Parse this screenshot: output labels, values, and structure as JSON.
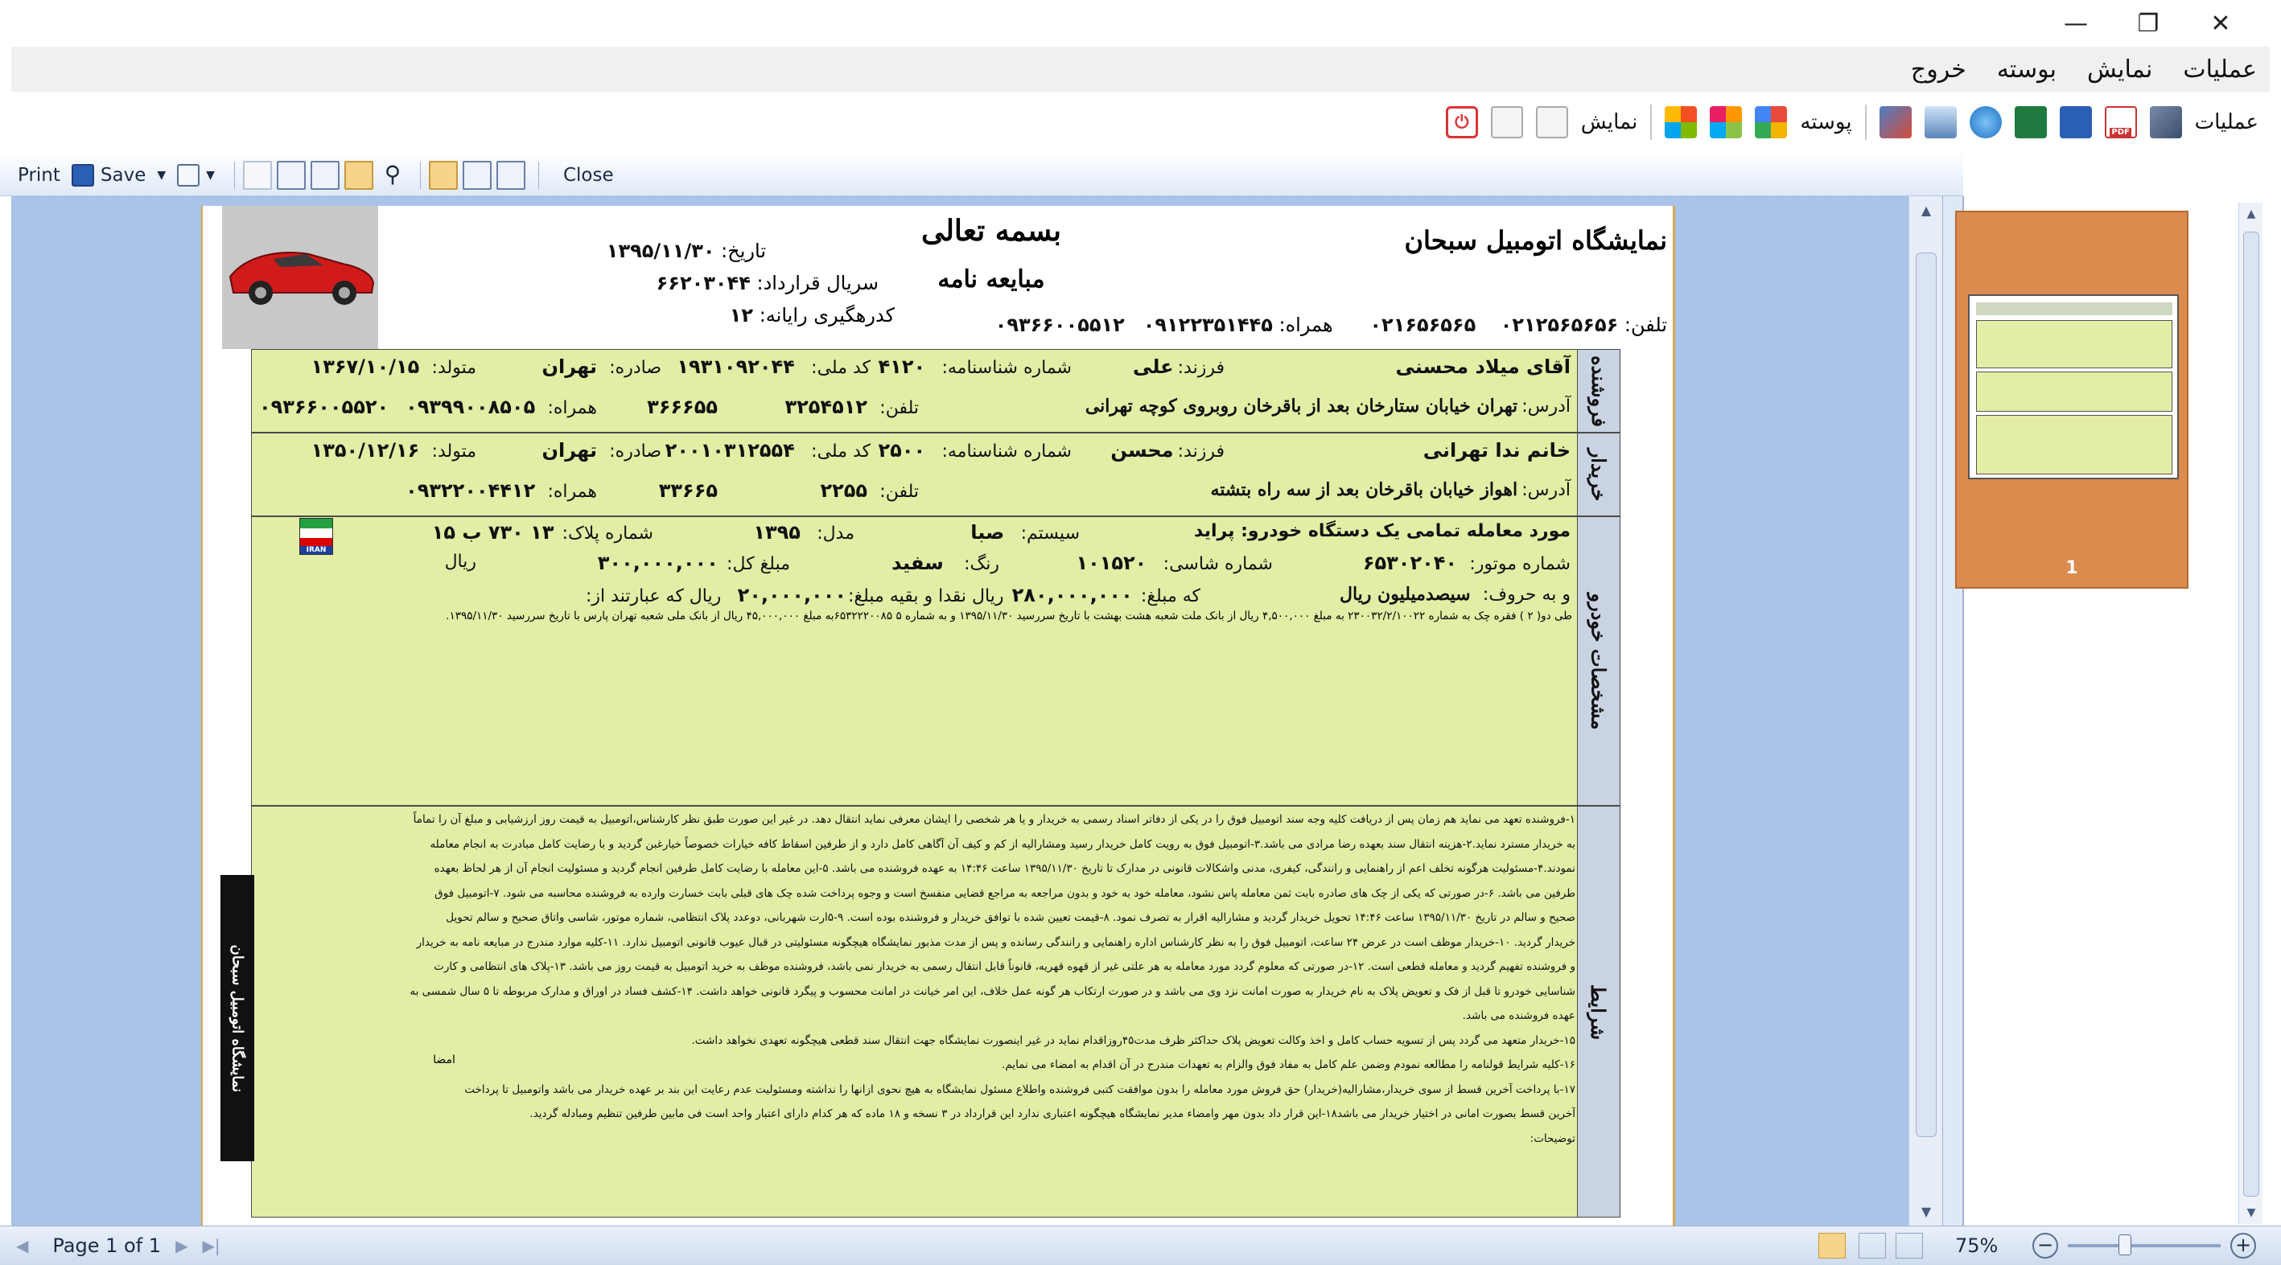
{
  "window": {
    "minimize_glyph": "—",
    "restore_glyph": "❐",
    "close_glyph": "✕"
  },
  "menu": {
    "items": [
      "عملیات",
      "نمایش",
      "بوسته",
      "خروج"
    ]
  },
  "icon_toolbar": {
    "operations_label": "عملیات",
    "skin_label": "پوسته",
    "view_label": "نمایش"
  },
  "viewer_toolbar": {
    "print_label": "Print",
    "save_label": "Save",
    "close_label": "Close"
  },
  "report": {
    "company_name": "نمایشگاه اتومبیل سبحان",
    "heading": "بسمه تعالی",
    "doc_title": "مبایعه نامه",
    "date_label": "تاریخ:",
    "date_value": "۱۳۹۵/۱۱/۳۰",
    "contract_serial_label": "سریال قرارداد:",
    "contract_serial_value": "۶۶۲۰۳۰۴۴",
    "tracking_label": "کدرهگیری رایانه:",
    "tracking_value": "۱۲",
    "phone_label": "تلفن:",
    "phone_1": "۰۲۱۲۵۶۵۶۵۶",
    "phone_2": "۰۲۱۶۵۶۵۶۵",
    "mobile_label": "همراه:",
    "mobile_1": "۰۹۱۲۲۳۵۱۴۴۵",
    "mobile_2": "۰۹۳۶۶۰۰۵۵۱۲",
    "seller": {
      "section_label": "فروشنده",
      "name": "آقای میلاد محسنی",
      "father_label": "فرزند:",
      "father": "علی",
      "id_no_label": "شماره شناسنامه:",
      "id_no": "۴۱۲۰",
      "national_code_label": "کد ملی:",
      "national_code": "۱۹۳۱۰۹۲۰۴۴",
      "issued_label": "صادره:",
      "issued": "تهران",
      "born_label": "متولد:",
      "born": "۱۳۶۷/۱۰/۱۵",
      "address_label": "آدرس:",
      "address": "تهران خیابان ستارخان بعد از باقرخان روبروی کوچه تهرانی",
      "phone_label": "تلفن:",
      "phone": "۳۲۵۴۵۱۲",
      "phone2": "۳۶۶۶۵۵",
      "mobile_label": "همراه:",
      "mobile": "۰۹۳۹۹۰۰۸۵۰۵",
      "mobile2": "۰۹۳۶۶۰۰۵۵۲۰"
    },
    "buyer": {
      "section_label": "خریدار",
      "name": "خانم ندا تهرانی",
      "father_label": "فرزند:",
      "father": "محسن",
      "id_no_label": "شماره شناسنامه:",
      "id_no": "۲۵۰۰",
      "national_code_label": "کد ملی:",
      "national_code": "۲۰۰۱۰۳۱۲۵۵۴",
      "issued_label": "صادره:",
      "issued": "تهران",
      "born_label": "متولد:",
      "born": "۱۳۵۰/۱۲/۱۶",
      "address_label": "آدرس:",
      "address": "اهواز خیابان باقرخان بعد از سه راه بتشته",
      "phone_label": "تلفن:",
      "phone": "۲۲۵۵",
      "phone2": "۳۳۶۶۵",
      "mobile_label": "همراه:",
      "mobile": "۰۹۳۲۲۰۰۴۴۱۲"
    },
    "vehicle": {
      "section_label": "مشخصات خودرو",
      "subject": "مورد معامله تمامی یک دستگاه خودرو: پراید",
      "system_label": "سیستم:",
      "system": "صبا",
      "model_label": "مدل:",
      "model": "۱۳۹۵",
      "plate_label": "شماره پلاک:",
      "plate": "۱۳ ۷۳۰ ب ۱۵",
      "plate_country": "IRAN",
      "engine_label": "شماره موتور:",
      "engine": "۶۵۳۰۲۰۴۰",
      "chassis_label": "شماره شاسی:",
      "chassis": "۱۰۱۵۲۰",
      "color_label": "رنگ:",
      "color": "سفید",
      "total_label": "مبلغ کل:",
      "total": "۳۰۰,۰۰۰,۰۰۰",
      "rial": "ریال",
      "words_label": "و به حروف:",
      "words": "سیصدمیلیون ریال",
      "paid_label": "که مبلغ:",
      "paid": "۲۸۰,۰۰۰,۰۰۰",
      "paid_suffix": "ریال نقدا و بقیه مبلغ:",
      "rest": "۲۰,۰۰۰,۰۰۰",
      "rest_suffix": "ریال که عبارتند از:",
      "cheques": "طی دو( ۲ ) فقره چک به شماره ۲۳۰۰۳۲/۲/۱۰۰۲۲ به مبلغ ۴,۵۰۰,۰۰۰ ریال  از بانک ملت شعبه هشت بهشت با تاریخ سررسید ۱۳۹۵/۱۱/۳۰ و به شماره ۵ ۶۵۳۲۲۲۰۰۸۵به مبلغ ۴۵,۰۰۰,۰۰۰ ریال  از بانک ملی شعبه تهران پارس با تاریخ سررسید ۱۳۹۵/۱۱/۳۰."
    },
    "terms": {
      "section_label": "شرایط",
      "side_stamp": "نمایشگاه اتومبیل سبحان",
      "lines": [
        "۱-فروشنده تعهد می نماید هم زمان پس از دریافت کلیه وجه سند اتومبیل فوق را در یکی از دفاتر اسناد رسمی به خریدار و یا هر شخصی را ایشان معرفی نماید انتقال دهد. در غیر این صورت طبق نظر کارشناس،اتومبیل به قیمت روز ارزشیابی و مبلغ آن را تماماً",
        "به خریدار مسترد نماید.۲-هزینه انتقال سند بعهده رضا مرادی می باشد.۳-اتومبیل فوق به رویت کامل خریدار رسید ومشارالیه از کم و کیف آن آگاهی کامل دارد و از طرفین اسقاط کافه خیارات خصوصاً خیارغبن گردید و با رضایت کامل مبادرت به انجام معامله",
        "نمودند.۴-مسئولیت هرگونه تخلف اعم از راهنمایی و رانندگی، کیفری، مدنی واشکالات قانونی در مدارک تا تاریخ ۱۳۹۵/۱۱/۳۰ ساعت ۱۴:۴۶ به عهده فروشنده می باشد. ۵-این معامله با رضایت کامل طرفین انجام گردید و مسئولیت انجام آن از هر لحاظ بعهده",
        "طرفین می باشد. ۶-در صورتی که یکی از چک های صادره بابت ثمن معامله پاس نشود، معامله خود به خود و بدون مراجعه به مراجع قضایی منفسخ است و وجوه پرداخت شده چک های قبلی بابت خسارت وارده به فروشنده محاسبه می شود. ۷-اتومبیل فوق",
        "صحیح و سالم در تاریخ ۱۳۹۵/۱۱/۳۰ ساعت ۱۴:۴۶ تحویل خریدار گردید و مشارالیه اقرار به تصرف نمود. ۸-قیمت تعیین شده با توافق خریدار و فروشنده بوده است. ۹-۵ارت شهربانی، دوعدد پلاک انتظامی، شماره موتور، شاسی واتاق صحیح و سالم تحویل",
        "خریدار گردید. ۱۰-خریدار موظف است در عرض ۲۴ ساعت، اتومبیل فوق را به نظر کارشناس اداره راهنمایی و رانندگی رسانده و پس از مدت مذبور نمایشگاه هیچگونه مسئولیتی در قبال عیوب قانونی اتومبیل ندارد. ۱۱-کلیه موارد مندرج در مبایعه نامه به خریدار",
        "و فروشنده تفهیم گردید و معامله قطعی است. ۱۲-در صورتی که معلوم گردد مورد معامله به هر علتی غیر از قهوه قهریه، قانوناً قابل انتقال رسمی به خریدار نمی باشد، فروشنده موظف به خرید اتومبیل به قیمت روز می باشد. ۱۳-پلاک های انتظامی و کارت",
        "شناسایی خودرو تا قبل از فک و تعویض پلاک به نام خریدار به صورت امانت نزد وی می باشد و در صورت ارتکاب هر گونه عمل خلاف، این امر خیانت در امانت محسوب و پیگرد قانونی خواهد داشت. ۱۴-کشف فساد در اوراق و مدارک مربوطه تا ۵ سال شمسی به",
        "عهده فروشنده می باشد.",
        "۱۵-خریدار متعهد می گردد پس از تسویه حساب کامل و اخذ وکالت تعویض پلاک حداکثر ظرف مدت۴۵روزاقدام نماید در غیر اینصورت نمایشگاه جهت انتقال سند قطعی هیچگونه تعهدی نخواهد داشت.",
        "۱۶-کلیه شرایط قولنامه را مطالعه نمودم وضمن علم کامل به مفاد فوق والزام به تعهدات مندرج در آن اقدام به امضاء می نمایم.",
        "۱۷-با پرداخت آخرین قسط از سوی خریدار،مشارالیه(خریدار) حق فروش مورد معامله را بدون موافقت کتبی فروشنده واطلاع مسئول نمایشگاه به هیچ نحوی ازانها را نداشته ومسئولیت عدم رعایت این بند بر عهده خریدار می باشد واتومبیل تا پرداخت",
        "آخرین قسط بصورت امانی در اختیار خریدار می باشد۱۸-این قرار داد بدون مهر وامضاء مدیر نمایشگاه هیچگونه اعتباری ندارد این قرارداد در ۳ نسخه و ۱۸ ماده که هر کدام دارای اعتبار واحد است فی مابین طرفین تنظیم ومبادله گردید.",
        "توضیحات:"
      ],
      "signature_label": "امضا"
    }
  },
  "thumbnails": {
    "page_number": "1"
  },
  "status": {
    "page_label": "Page 1 of 1",
    "zoom": "75%",
    "zoom_value": 0.75
  },
  "colors": {
    "viewer_background": "#a9c4e8",
    "form_fill": "#e4eda6",
    "section_header": "#c9d3e2",
    "thumbnail_selected": "#dc8b4e"
  }
}
